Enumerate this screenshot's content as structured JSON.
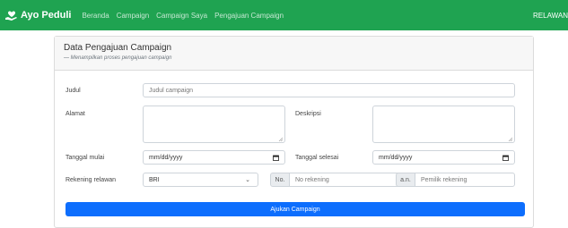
{
  "navbar": {
    "brand": "Ayo Peduli",
    "links": [
      "Beranda",
      "Campaign",
      "Campaign Saya",
      "Pengajuan Campaign"
    ],
    "user": "RELAWAN",
    "color": "#1fa351"
  },
  "card": {
    "title": "Data Pengajuan Campaign",
    "subtitle": "— Menampilkan proses pengajuan campaign"
  },
  "form": {
    "judul_label": "Judul",
    "judul_placeholder": "Judul campaign",
    "alamat_label": "Alamat",
    "deskripsi_label": "Deskripsi",
    "tanggal_mulai_label": "Tanggal mulai",
    "tanggal_mulai_value": "mm/dd/yyyy",
    "tanggal_selesai_label": "Tanggal selesai",
    "tanggal_selesai_value": "mm/dd/yyyy",
    "rekening_label": "Rekening relawan",
    "bank_value": "BRI",
    "no_addon": "No.",
    "no_placeholder": "No rekening",
    "an_addon": "a.n.",
    "an_placeholder": "Pemilik rekening",
    "submit_label": "Ajukan Campaign",
    "submit_color": "#0d6efd"
  }
}
